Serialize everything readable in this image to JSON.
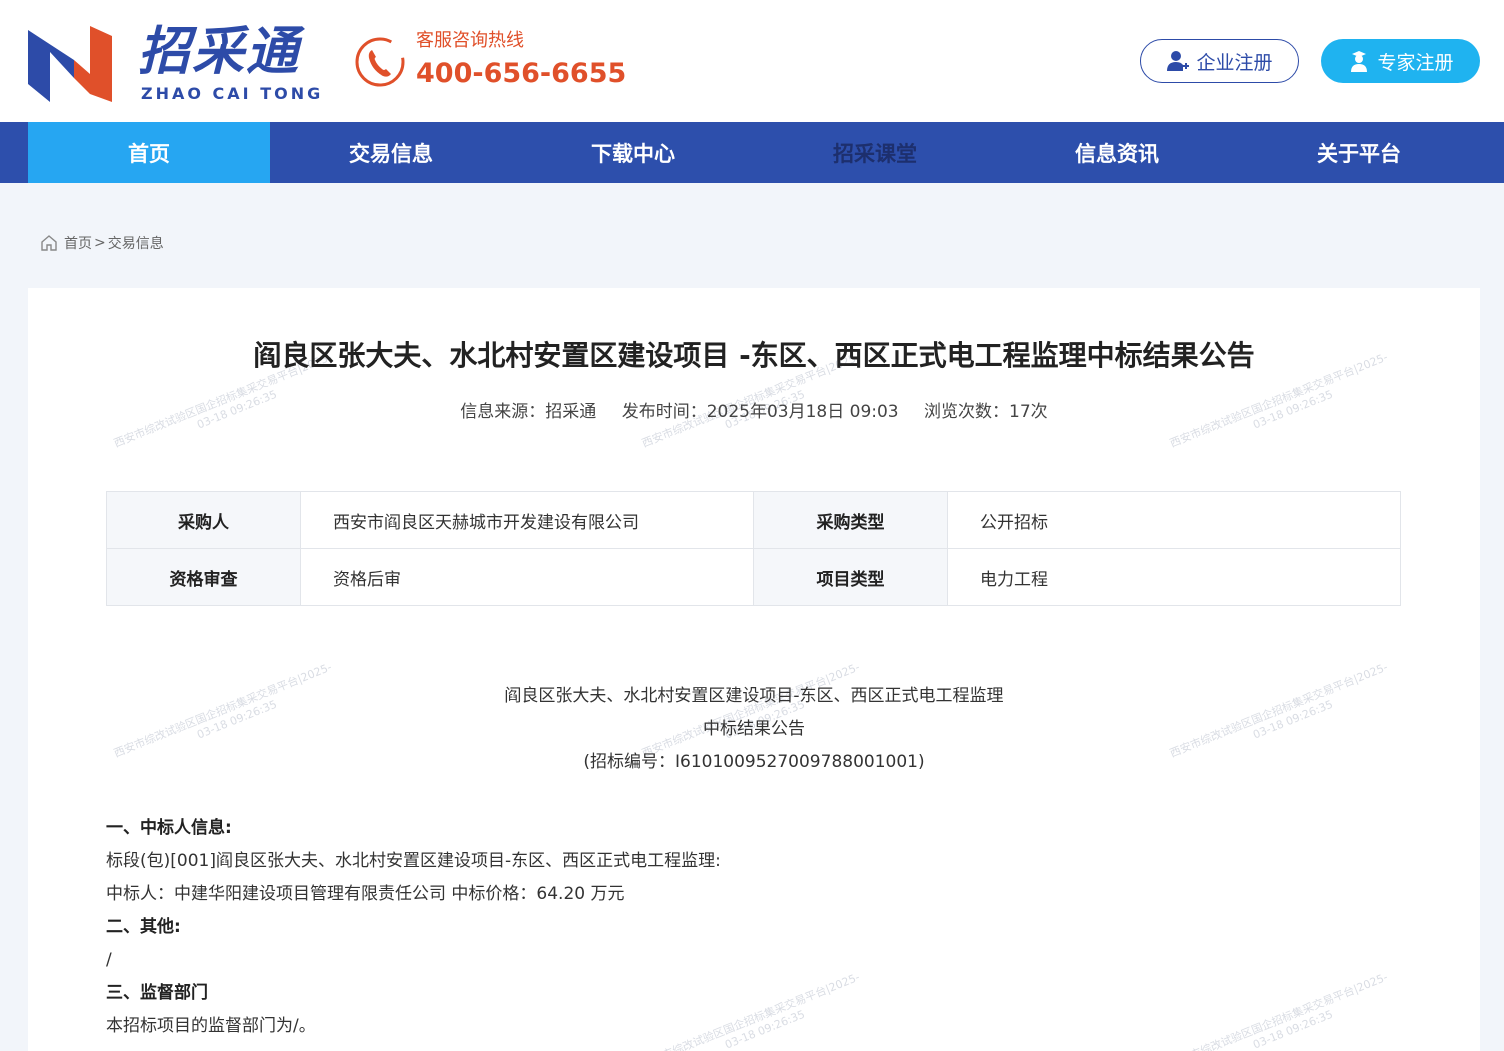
{
  "header": {
    "logo_cn": "招采通",
    "logo_en": "ZHAO CAI TONG",
    "hotline_label": "客服咨询热线",
    "hotline_number": "400-656-6655",
    "company_register": "企业注册",
    "expert_register": "专家注册"
  },
  "nav": {
    "items": [
      "首页",
      "交易信息",
      "下载中心",
      "招采课堂",
      "信息资讯",
      "关于平台"
    ]
  },
  "breadcrumb": {
    "home": "首页",
    "separator": ">",
    "current": "交易信息"
  },
  "watermark": {
    "line1": "西安市综改试验区国企招标集采交易平台|2025-",
    "line2": "03-18 09:26:35"
  },
  "article": {
    "title": "阎良区张大夫、水北村安置区建设项目 -东区、西区正式电工程监理中标结果公告",
    "source": "信息来源：招采通",
    "publish_time": "发布时间：2025年03月18日 09:03",
    "views": "浏览次数：17次"
  },
  "info_table": {
    "rows": [
      {
        "label1": "采购人",
        "value1": "西安市阎良区天赫城市开发建设有限公司",
        "label2": "采购类型",
        "value2": "公开招标"
      },
      {
        "label1": "资格审查",
        "value1": "资格后审",
        "label2": "项目类型",
        "value2": "电力工程"
      }
    ]
  },
  "document": {
    "heading1": "阎良区张大夫、水北村安置区建设项目-东区、西区正式电工程监理",
    "heading2": "中标结果公告",
    "heading3": "(招标编号：I6101009527009788001001)",
    "lines": [
      "一、中标人信息:",
      "标段(包)[001]阎良区张大夫、水北村安置区建设项目-东区、西区正式电工程监理:",
      "中标人：中建华阳建设项目管理有限责任公司 中标价格：64.20 万元",
      "二、其他:",
      "/",
      "三、监督部门",
      "本招标项目的监督部门为/。"
    ]
  }
}
